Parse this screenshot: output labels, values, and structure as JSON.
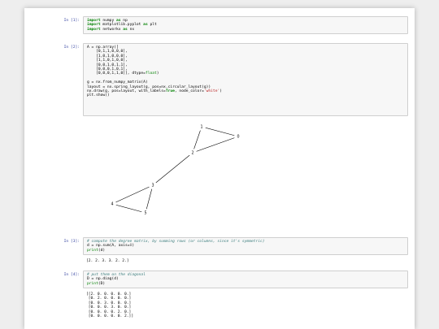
{
  "cells": [
    {
      "prompt": "In [1]:",
      "code_lines": [
        [
          {
            "t": "import",
            "c": "kw"
          },
          {
            "t": " numpy ",
            "c": ""
          },
          {
            "t": "as",
            "c": "kw"
          },
          {
            "t": " np",
            "c": ""
          }
        ],
        [
          {
            "t": "import",
            "c": "kw"
          },
          {
            "t": " matplotlib.pyplot ",
            "c": ""
          },
          {
            "t": "as",
            "c": "kw"
          },
          {
            "t": " plt",
            "c": ""
          }
        ],
        [
          {
            "t": "import",
            "c": "kw"
          },
          {
            "t": " networkx ",
            "c": ""
          },
          {
            "t": "as",
            "c": "kw"
          },
          {
            "t": " nx",
            "c": ""
          }
        ]
      ]
    },
    {
      "prompt": "In [2]:",
      "code_lines": [
        [
          {
            "t": "A = np.array([",
            "c": ""
          }
        ],
        [
          {
            "t": "    [0,1,1,0,0,0],",
            "c": ""
          }
        ],
        [
          {
            "t": "    [1,0,1,0,0,0],",
            "c": ""
          }
        ],
        [
          {
            "t": "    [1,1,0,1,0,0],",
            "c": ""
          }
        ],
        [
          {
            "t": "    [0,0,1,0,1,1],",
            "c": ""
          }
        ],
        [
          {
            "t": "    [0,0,0,1,0,1],",
            "c": ""
          }
        ],
        [
          {
            "t": "    [0,0,0,1,1,0]], dtype=",
            "c": ""
          },
          {
            "t": "float",
            "c": "bi"
          },
          {
            "t": ")",
            "c": ""
          }
        ],
        [
          {
            "t": "",
            "c": ""
          }
        ],
        [
          {
            "t": "g = nx.from_numpy_matrix(A)",
            "c": ""
          }
        ],
        [
          {
            "t": "layout = nx.spring_layout(g, pos=nx.circular_layout(g))",
            "c": ""
          }
        ],
        [
          {
            "t": "nx.draw(g, pos=layout, with_labels=",
            "c": ""
          },
          {
            "t": "True",
            "c": "kw"
          },
          {
            "t": ", node_color=",
            "c": ""
          },
          {
            "t": "'white'",
            "c": "st"
          },
          {
            "t": ")",
            "c": ""
          }
        ],
        [
          {
            "t": "plt.show()",
            "c": ""
          }
        ]
      ],
      "graph": {
        "nodes": [
          {
            "id": "0",
            "label": "0"
          },
          {
            "id": "1",
            "label": "1"
          },
          {
            "id": "2",
            "label": "2"
          },
          {
            "id": "3",
            "label": "3"
          },
          {
            "id": "4",
            "label": "4"
          },
          {
            "id": "5",
            "label": "5"
          }
        ],
        "edges": [
          [
            "0",
            "1"
          ],
          [
            "0",
            "2"
          ],
          [
            "1",
            "2"
          ],
          [
            "2",
            "3"
          ],
          [
            "3",
            "4"
          ],
          [
            "3",
            "5"
          ],
          [
            "4",
            "5"
          ]
        ]
      }
    },
    {
      "prompt": "In [3]:",
      "code_lines": [
        [
          {
            "t": "# compute the degree matrix, by summing rows (or columns, since it's symmetric)",
            "c": "cm"
          }
        ],
        [
          {
            "t": "d = np.sum(A, axis=",
            "c": ""
          },
          {
            "t": "0",
            "c": "num"
          },
          {
            "t": ")",
            "c": ""
          }
        ],
        [
          {
            "t": "print",
            "c": "bi"
          },
          {
            "t": "(d)",
            "c": ""
          }
        ]
      ],
      "output": "[2. 2. 3. 3. 2. 2.]"
    },
    {
      "prompt": "In [4]:",
      "code_lines": [
        [
          {
            "t": "# put them on the diagonal",
            "c": "cm"
          }
        ],
        [
          {
            "t": "D = np.diag(d)",
            "c": ""
          }
        ],
        [
          {
            "t": "print",
            "c": "bi"
          },
          {
            "t": "(D)",
            "c": ""
          }
        ]
      ],
      "output": "[[2. 0. 0. 0. 0. 0.]\n [0. 2. 0. 0. 0. 0.]\n [0. 0. 3. 0. 0. 0.]\n [0. 0. 0. 3. 0. 0.]\n [0. 0. 0. 0. 2. 0.]\n [0. 0. 0. 0. 0. 2.]]"
    }
  ]
}
